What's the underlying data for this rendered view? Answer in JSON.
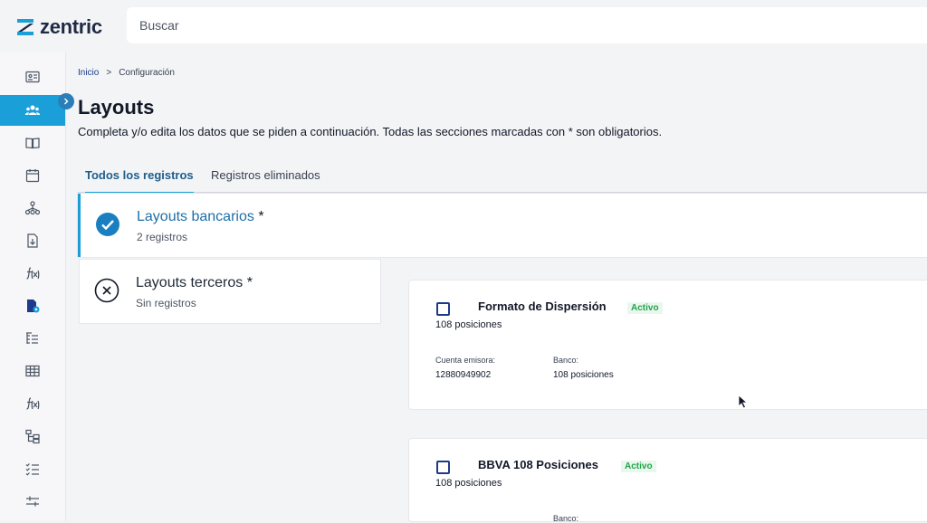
{
  "app": {
    "logo_text": "zentric"
  },
  "search": {
    "placeholder": "Buscar"
  },
  "breadcrumb": {
    "home": "Inicio",
    "separator": ">",
    "current": "Configuración"
  },
  "page": {
    "title": "Layouts",
    "subtitle": "Completa y/o edita los datos que se piden a continuación. Todas las secciones marcadas con * son obligatorios."
  },
  "tabs": [
    {
      "label": "Todos los registros",
      "active": true
    },
    {
      "label": "Registros eliminados",
      "active": false
    }
  ],
  "categories": [
    {
      "title": "Layouts bancarios",
      "required": "*",
      "subtitle": "2 registros",
      "state": "check",
      "active": true
    },
    {
      "title": "Layouts terceros",
      "required": "*",
      "subtitle": "Sin registros",
      "state": "cross",
      "active": false
    }
  ],
  "records": [
    {
      "title": "Formato de Dispersión",
      "status": "Activo",
      "positions": "108 posiciones",
      "fields": [
        {
          "label": "Cuenta emisora:",
          "value": "12880949902"
        },
        {
          "label": "Banco:",
          "value": "108 posiciones"
        }
      ]
    },
    {
      "title": "BBVA 108 Posiciones",
      "status": "Activo",
      "positions": "108 posiciones",
      "fields": [
        {
          "label": "",
          "value": ""
        },
        {
          "label": "Banco:",
          "value": ""
        }
      ]
    }
  ],
  "sidebar": {
    "icons": [
      "id-card-icon",
      "users-icon",
      "book-icon",
      "calendar-icon",
      "org-chart-icon",
      "document-download-icon",
      "function-icon",
      "document-settings-icon",
      "list-tree-icon",
      "table-icon",
      "function-icon",
      "hierarchy-icon",
      "checklist-icon",
      "sliders-icon"
    ],
    "active_index": 1
  },
  "colors": {
    "accent": "#1a9fd9",
    "active_status": "#22a34a",
    "brand_dark": "#1f2a44"
  }
}
